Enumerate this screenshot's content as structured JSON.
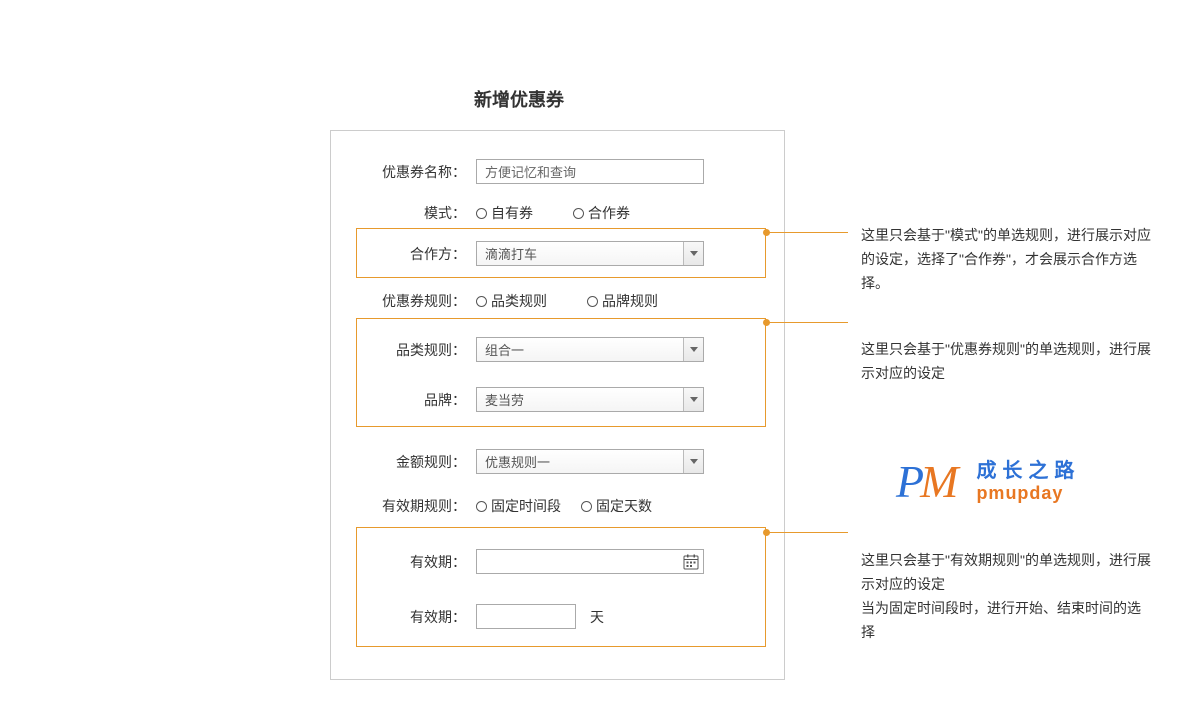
{
  "title": "新增优惠券",
  "form": {
    "coupon_name": {
      "label": "优惠券名称：",
      "value": "方便记忆和查询"
    },
    "mode": {
      "label": "模式：",
      "options": [
        "自有券",
        "合作券"
      ]
    },
    "partner": {
      "label": "合作方：",
      "value": "滴滴打车"
    },
    "coupon_rule": {
      "label": "优惠券规则：",
      "options": [
        "品类规则",
        "品牌规则"
      ]
    },
    "category_rule": {
      "label": "品类规则：",
      "value": "组合一"
    },
    "brand": {
      "label": "品牌：",
      "value": "麦当劳"
    },
    "amount_rule": {
      "label": "金额规则：",
      "value": "优惠规则一"
    },
    "validity_rule": {
      "label": "有效期规则：",
      "options": [
        "固定时间段",
        "固定天数"
      ]
    },
    "validity_period": {
      "label": "有效期："
    },
    "validity_days": {
      "label": "有效期：",
      "unit": "天"
    }
  },
  "annotations": {
    "a1": "这里只会基于\"模式\"的单选规则，进行展示对应的设定，选择了\"合作券\"，才会展示合作方选择。",
    "a2": "这里只会基于\"优惠券规则\"的单选规则，进行展示对应的设定",
    "a3": "这里只会基于\"有效期规则\"的单选规则，进行展示对应的设定\n当为固定时间段时，进行开始、结束时间的选择"
  },
  "logo": {
    "p": "P",
    "m": "M",
    "cn": "成长之路",
    "en": "pmupday"
  }
}
